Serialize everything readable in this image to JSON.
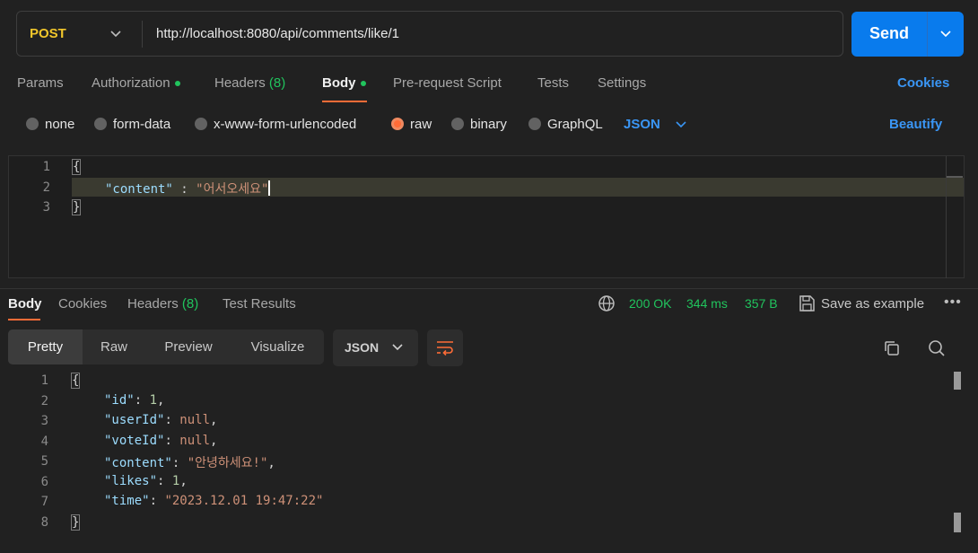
{
  "request": {
    "method": "POST",
    "url": "http://localhost:8080/api/comments/like/1",
    "send_label": "Send"
  },
  "request_tabs": {
    "params": "Params",
    "authorization": "Authorization",
    "headers": "Headers",
    "headers_count": "(8)",
    "body": "Body",
    "pre_request": "Pre-request Script",
    "tests": "Tests",
    "settings": "Settings",
    "cookies": "Cookies"
  },
  "body_types": {
    "none": "none",
    "form_data": "form-data",
    "urlencoded": "x-www-form-urlencoded",
    "raw": "raw",
    "binary": "binary",
    "graphql": "GraphQL",
    "language": "JSON",
    "beautify": "Beautify",
    "selected": "raw"
  },
  "request_body": {
    "line_numbers": [
      "1",
      "2",
      "3"
    ],
    "open_brace": "{",
    "key": "\"content\"",
    "sep": " : ",
    "value": "\"어서오세요\"",
    "close_brace": "}"
  },
  "response_tabs": {
    "body": "Body",
    "cookies": "Cookies",
    "headers": "Headers",
    "headers_count": "(8)",
    "test_results": "Test Results"
  },
  "response_meta": {
    "status": "200 OK",
    "time": "344 ms",
    "size": "357 B",
    "save_example": "Save as example",
    "more": "•••"
  },
  "response_view": {
    "pretty": "Pretty",
    "raw": "Raw",
    "preview": "Preview",
    "visualize": "Visualize",
    "language": "JSON"
  },
  "response_body": {
    "line_numbers": [
      "1",
      "2",
      "3",
      "4",
      "5",
      "6",
      "7",
      "8"
    ],
    "open_brace": "{",
    "close_brace": "}",
    "id_key": "\"id\"",
    "id_val": "1",
    "userId_key": "\"userId\"",
    "userId_val": "null",
    "voteId_key": "\"voteId\"",
    "voteId_val": "null",
    "content_key": "\"content\"",
    "content_val": "\"안녕하세요!\"",
    "likes_key": "\"likes\"",
    "likes_val": "1",
    "time_key": "\"time\"",
    "time_val": "\"2023.12.01 19:47:22\""
  },
  "colors": {
    "accent_orange": "#ff6c37",
    "send_blue": "#097bed",
    "link_blue": "#3a96f5",
    "status_green": "#21c45d",
    "method_yellow": "#f1c62b"
  },
  "icons": [
    "chevron-down-icon",
    "globe-icon",
    "save-icon",
    "wrap-lines-icon",
    "copy-icon",
    "search-icon",
    "more-icon"
  ]
}
